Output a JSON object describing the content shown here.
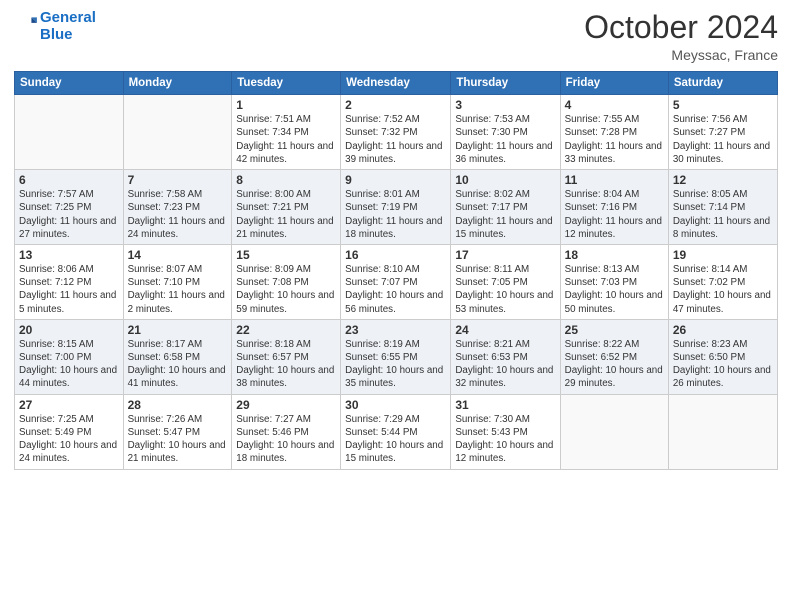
{
  "header": {
    "logo_line1": "General",
    "logo_line2": "Blue",
    "month": "October 2024",
    "location": "Meyssac, France"
  },
  "weekdays": [
    "Sunday",
    "Monday",
    "Tuesday",
    "Wednesday",
    "Thursday",
    "Friday",
    "Saturday"
  ],
  "weeks": [
    [
      {
        "day": "",
        "info": ""
      },
      {
        "day": "",
        "info": ""
      },
      {
        "day": "1",
        "info": "Sunrise: 7:51 AM\nSunset: 7:34 PM\nDaylight: 11 hours and 42 minutes."
      },
      {
        "day": "2",
        "info": "Sunrise: 7:52 AM\nSunset: 7:32 PM\nDaylight: 11 hours and 39 minutes."
      },
      {
        "day": "3",
        "info": "Sunrise: 7:53 AM\nSunset: 7:30 PM\nDaylight: 11 hours and 36 minutes."
      },
      {
        "day": "4",
        "info": "Sunrise: 7:55 AM\nSunset: 7:28 PM\nDaylight: 11 hours and 33 minutes."
      },
      {
        "day": "5",
        "info": "Sunrise: 7:56 AM\nSunset: 7:27 PM\nDaylight: 11 hours and 30 minutes."
      }
    ],
    [
      {
        "day": "6",
        "info": "Sunrise: 7:57 AM\nSunset: 7:25 PM\nDaylight: 11 hours and 27 minutes."
      },
      {
        "day": "7",
        "info": "Sunrise: 7:58 AM\nSunset: 7:23 PM\nDaylight: 11 hours and 24 minutes."
      },
      {
        "day": "8",
        "info": "Sunrise: 8:00 AM\nSunset: 7:21 PM\nDaylight: 11 hours and 21 minutes."
      },
      {
        "day": "9",
        "info": "Sunrise: 8:01 AM\nSunset: 7:19 PM\nDaylight: 11 hours and 18 minutes."
      },
      {
        "day": "10",
        "info": "Sunrise: 8:02 AM\nSunset: 7:17 PM\nDaylight: 11 hours and 15 minutes."
      },
      {
        "day": "11",
        "info": "Sunrise: 8:04 AM\nSunset: 7:16 PM\nDaylight: 11 hours and 12 minutes."
      },
      {
        "day": "12",
        "info": "Sunrise: 8:05 AM\nSunset: 7:14 PM\nDaylight: 11 hours and 8 minutes."
      }
    ],
    [
      {
        "day": "13",
        "info": "Sunrise: 8:06 AM\nSunset: 7:12 PM\nDaylight: 11 hours and 5 minutes."
      },
      {
        "day": "14",
        "info": "Sunrise: 8:07 AM\nSunset: 7:10 PM\nDaylight: 11 hours and 2 minutes."
      },
      {
        "day": "15",
        "info": "Sunrise: 8:09 AM\nSunset: 7:08 PM\nDaylight: 10 hours and 59 minutes."
      },
      {
        "day": "16",
        "info": "Sunrise: 8:10 AM\nSunset: 7:07 PM\nDaylight: 10 hours and 56 minutes."
      },
      {
        "day": "17",
        "info": "Sunrise: 8:11 AM\nSunset: 7:05 PM\nDaylight: 10 hours and 53 minutes."
      },
      {
        "day": "18",
        "info": "Sunrise: 8:13 AM\nSunset: 7:03 PM\nDaylight: 10 hours and 50 minutes."
      },
      {
        "day": "19",
        "info": "Sunrise: 8:14 AM\nSunset: 7:02 PM\nDaylight: 10 hours and 47 minutes."
      }
    ],
    [
      {
        "day": "20",
        "info": "Sunrise: 8:15 AM\nSunset: 7:00 PM\nDaylight: 10 hours and 44 minutes."
      },
      {
        "day": "21",
        "info": "Sunrise: 8:17 AM\nSunset: 6:58 PM\nDaylight: 10 hours and 41 minutes."
      },
      {
        "day": "22",
        "info": "Sunrise: 8:18 AM\nSunset: 6:57 PM\nDaylight: 10 hours and 38 minutes."
      },
      {
        "day": "23",
        "info": "Sunrise: 8:19 AM\nSunset: 6:55 PM\nDaylight: 10 hours and 35 minutes."
      },
      {
        "day": "24",
        "info": "Sunrise: 8:21 AM\nSunset: 6:53 PM\nDaylight: 10 hours and 32 minutes."
      },
      {
        "day": "25",
        "info": "Sunrise: 8:22 AM\nSunset: 6:52 PM\nDaylight: 10 hours and 29 minutes."
      },
      {
        "day": "26",
        "info": "Sunrise: 8:23 AM\nSunset: 6:50 PM\nDaylight: 10 hours and 26 minutes."
      }
    ],
    [
      {
        "day": "27",
        "info": "Sunrise: 7:25 AM\nSunset: 5:49 PM\nDaylight: 10 hours and 24 minutes."
      },
      {
        "day": "28",
        "info": "Sunrise: 7:26 AM\nSunset: 5:47 PM\nDaylight: 10 hours and 21 minutes."
      },
      {
        "day": "29",
        "info": "Sunrise: 7:27 AM\nSunset: 5:46 PM\nDaylight: 10 hours and 18 minutes."
      },
      {
        "day": "30",
        "info": "Sunrise: 7:29 AM\nSunset: 5:44 PM\nDaylight: 10 hours and 15 minutes."
      },
      {
        "day": "31",
        "info": "Sunrise: 7:30 AM\nSunset: 5:43 PM\nDaylight: 10 hours and 12 minutes."
      },
      {
        "day": "",
        "info": ""
      },
      {
        "day": "",
        "info": ""
      }
    ]
  ]
}
